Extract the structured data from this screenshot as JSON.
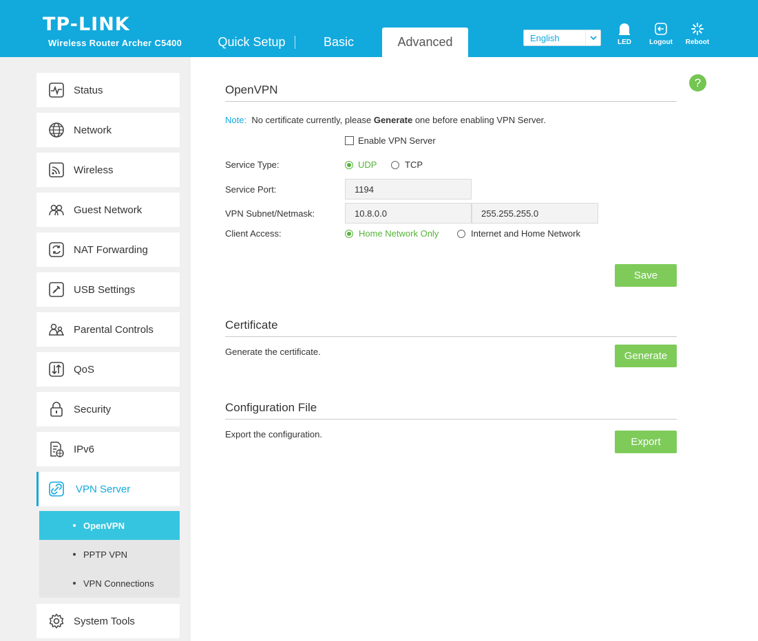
{
  "header": {
    "brand": "TP-LINK",
    "model": "Wireless Router Archer C5400",
    "tabs": [
      "Quick Setup",
      "Basic",
      "Advanced"
    ],
    "language": "English",
    "buttons": {
      "led": "LED",
      "logout": "Logout",
      "reboot": "Reboot"
    }
  },
  "sidebar": {
    "items": [
      {
        "label": "Status",
        "icon": "status-icon"
      },
      {
        "label": "Network",
        "icon": "globe-icon"
      },
      {
        "label": "Wireless",
        "icon": "wireless-icon"
      },
      {
        "label": "Guest Network",
        "icon": "guest-icon"
      },
      {
        "label": "NAT Forwarding",
        "icon": "nat-icon"
      },
      {
        "label": "USB Settings",
        "icon": "usb-icon"
      },
      {
        "label": "Parental Controls",
        "icon": "parental-icon"
      },
      {
        "label": "QoS",
        "icon": "qos-icon"
      },
      {
        "label": "Security",
        "icon": "lock-icon"
      },
      {
        "label": "IPv6",
        "icon": "ipv6-icon"
      },
      {
        "label": "VPN Server",
        "icon": "vpn-icon"
      },
      {
        "label": "System Tools",
        "icon": "gear-icon"
      }
    ],
    "submenu": [
      "OpenVPN",
      "PPTP VPN",
      "VPN Connections"
    ]
  },
  "main": {
    "help": "?",
    "openvpn": {
      "title": "OpenVPN",
      "note_label": "Note:",
      "note_pre": "No certificate currently, please",
      "note_bold": "Generate",
      "note_post": "one before enabling VPN Server.",
      "enable_label": "Enable VPN Server",
      "service_type_label": "Service Type:",
      "udp": "UDP",
      "tcp": "TCP",
      "service_port_label": "Service Port:",
      "service_port": "1194",
      "subnet_label": "VPN Subnet/Netmask:",
      "subnet": "10.8.0.0",
      "netmask": "255.255.255.0",
      "client_access_label": "Client Access:",
      "home_only": "Home Network Only",
      "internet_home": "Internet and Home Network",
      "save": "Save"
    },
    "certificate": {
      "title": "Certificate",
      "desc": "Generate the certificate.",
      "button": "Generate"
    },
    "config": {
      "title": "Configuration File",
      "desc": "Export the configuration.",
      "button": "Export"
    }
  },
  "colors": {
    "brand": "#12a9dd",
    "accent_green": "#7ecb5a",
    "active_sub": "#36c5e0"
  }
}
